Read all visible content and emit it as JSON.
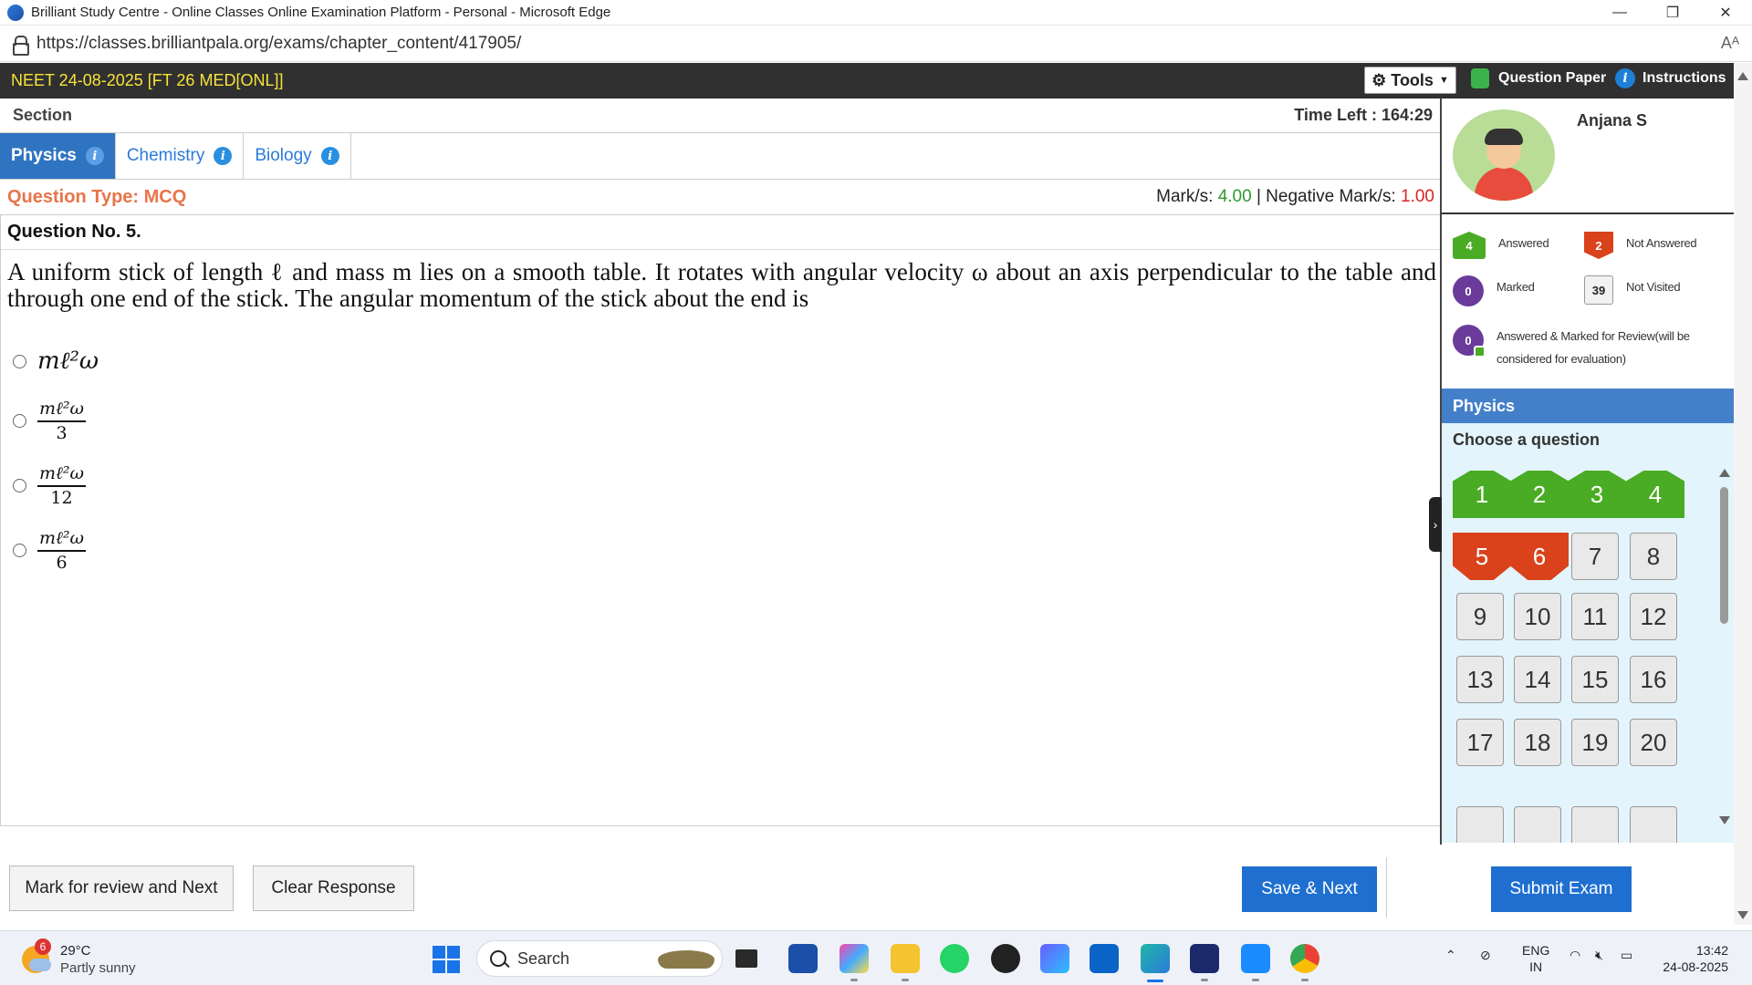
{
  "browser": {
    "title": "Brilliant Study Centre - Online Classes Online Examination Platform - Personal - Microsoft Edge",
    "url": "https://classes.brilliantpala.org/exams/chapter_content/417905/",
    "controls": {
      "minimize": "—",
      "restore": "❐",
      "close": "✕"
    },
    "readaloud": "Aᴬ"
  },
  "exam": {
    "name": "NEET 24-08-2025 [FT 26 MED[ONL]]",
    "tools_label": "Tools",
    "question_paper_label": "Question Paper",
    "instructions_label": "Instructions"
  },
  "section": {
    "label": "Section",
    "time_left": "Time Left : 164:29",
    "tabs": [
      {
        "label": "Physics",
        "active": true
      },
      {
        "label": "Chemistry",
        "active": false
      },
      {
        "label": "Biology",
        "active": false
      }
    ]
  },
  "question": {
    "type_label": "Question Type: MCQ",
    "marks_prefix": "Mark/s: ",
    "marks_value": "4.00",
    "neg_prefix": " | Negative Mark/s: ",
    "neg_value": "1.00",
    "number_label": "Question No. 5.",
    "text": "A uniform stick of length ℓ and mass m lies on a smooth table. It rotates with angular velocity ω about an axis perpendicular to the table and through one end of the stick. The angular momentum of the stick about the end is",
    "options": [
      {
        "num": "mℓ²ω",
        "den": ""
      },
      {
        "num": "mℓ²ω",
        "den": "3"
      },
      {
        "num": "mℓ²ω",
        "den": "12"
      },
      {
        "num": "mℓ²ω",
        "den": "6"
      }
    ]
  },
  "candidate": {
    "name": "Anjana S"
  },
  "legend": {
    "answered": {
      "count": "4",
      "label": "Answered"
    },
    "not_answered": {
      "count": "2",
      "label": "Not Answered"
    },
    "marked": {
      "count": "0",
      "label": "Marked"
    },
    "not_visited": {
      "count": "39",
      "label": "Not Visited"
    },
    "answered_marked": {
      "count": "0",
      "label_line1": "Answered & Marked for Review(will be",
      "label_line2": "considered for evaluation)"
    }
  },
  "palette": {
    "subject": "Physics",
    "choose_label": "Choose a question",
    "questions": [
      {
        "n": "1",
        "status": "ans"
      },
      {
        "n": "2",
        "status": "ans"
      },
      {
        "n": "3",
        "status": "ans"
      },
      {
        "n": "4",
        "status": "ans"
      },
      {
        "n": "5",
        "status": "nans"
      },
      {
        "n": "6",
        "status": "nans"
      },
      {
        "n": "7",
        "status": "nv"
      },
      {
        "n": "8",
        "status": "nv"
      },
      {
        "n": "9",
        "status": "nv"
      },
      {
        "n": "10",
        "status": "nv"
      },
      {
        "n": "11",
        "status": "nv"
      },
      {
        "n": "12",
        "status": "nv"
      },
      {
        "n": "13",
        "status": "nv"
      },
      {
        "n": "14",
        "status": "nv"
      },
      {
        "n": "15",
        "status": "nv"
      },
      {
        "n": "16",
        "status": "nv"
      },
      {
        "n": "17",
        "status": "nv"
      },
      {
        "n": "18",
        "status": "nv"
      },
      {
        "n": "19",
        "status": "nv"
      },
      {
        "n": "20",
        "status": "nv"
      }
    ]
  },
  "actions": {
    "mark_review": "Mark for review and Next",
    "clear": "Clear Response",
    "save_next": "Save & Next",
    "submit": "Submit Exam"
  },
  "taskbar": {
    "weather_temp": "29°C",
    "weather_cond": "Partly sunny",
    "weather_badge": "6",
    "search_label": "Search",
    "lang1": "ENG",
    "lang2": "IN",
    "time": "13:42",
    "date": "24-08-2025"
  },
  "colors": {
    "answered": "#4aab24",
    "not_answered": "#d9421b",
    "marked": "#6a3b9b",
    "accent_blue": "#1e6fcf",
    "exam_title_yellow": "#f6e33b"
  }
}
